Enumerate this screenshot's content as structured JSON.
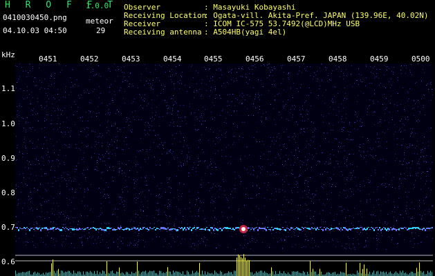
{
  "header": {
    "app_title": "H R O F F T",
    "version": "1.0.0",
    "file_name": "0410030450.png",
    "date_time": "04.10.03 04:50",
    "meteor_label": "meteor",
    "meteor_count": "29"
  },
  "info": [
    {
      "label": "Observer",
      "value": ": Masayuki Kobayashi"
    },
    {
      "label": "Receiving Location",
      "value": ": Ogata-vill. Akita-Pref. JAPAN (139.96E, 40.02N)"
    },
    {
      "label": "Receiver",
      "value": ": ICOM IC-575 53.7492(@LCD)MHz USB"
    },
    {
      "label": "Receiving antenna",
      "value": ": A504HB(yagi 4el)"
    }
  ],
  "axis": {
    "unit": "kHz",
    "time_ticks": [
      "0451",
      "0452",
      "0453",
      "0454",
      "0455",
      "0456",
      "0457",
      "0458",
      "0459",
      "0500"
    ],
    "freq_ticks": [
      "1.1",
      "1.0",
      "0.9",
      "0.8",
      "0.7",
      "0.6"
    ]
  },
  "colors": {
    "background": "#000000",
    "title_green": "#2ee86a",
    "info_yellow": "#ffff66",
    "noise_blue": "#2a2aa8",
    "trace_cyan": "#33ccff",
    "spectrum_yellow": "#ffff00"
  }
}
